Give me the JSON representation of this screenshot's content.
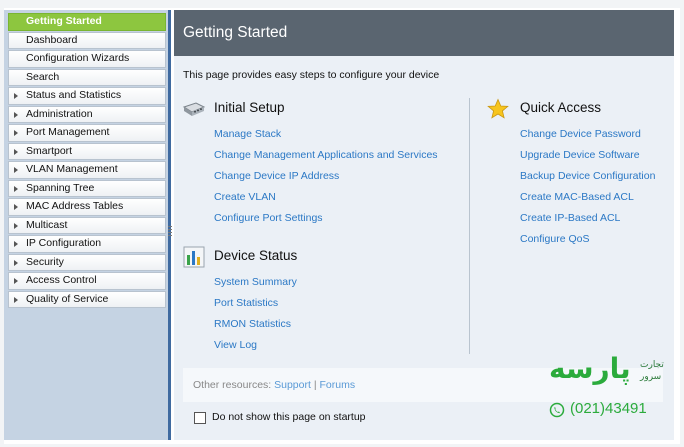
{
  "sidebar": {
    "items": [
      {
        "label": "Getting Started",
        "active": true,
        "arrow": false
      },
      {
        "label": "Dashboard",
        "active": false,
        "arrow": false
      },
      {
        "label": "Configuration Wizards",
        "active": false,
        "arrow": false
      },
      {
        "label": "Search",
        "active": false,
        "arrow": false
      },
      {
        "label": "Status and Statistics",
        "active": false,
        "arrow": true
      },
      {
        "label": "Administration",
        "active": false,
        "arrow": true
      },
      {
        "label": "Port Management",
        "active": false,
        "arrow": true
      },
      {
        "label": "Smartport",
        "active": false,
        "arrow": true
      },
      {
        "label": "VLAN Management",
        "active": false,
        "arrow": true
      },
      {
        "label": "Spanning Tree",
        "active": false,
        "arrow": true
      },
      {
        "label": "MAC Address Tables",
        "active": false,
        "arrow": true
      },
      {
        "label": "Multicast",
        "active": false,
        "arrow": true
      },
      {
        "label": "IP Configuration",
        "active": false,
        "arrow": true
      },
      {
        "label": "Security",
        "active": false,
        "arrow": true
      },
      {
        "label": "Access Control",
        "active": false,
        "arrow": true
      },
      {
        "label": "Quality of Service",
        "active": false,
        "arrow": true
      }
    ]
  },
  "main": {
    "title": "Getting Started",
    "intro": "This page provides easy steps to configure your device",
    "initial_setup": {
      "title": "Initial Setup",
      "links": [
        "Manage Stack",
        "Change Management Applications and Services",
        "Change Device IP Address",
        "Create VLAN",
        "Configure Port Settings"
      ]
    },
    "device_status": {
      "title": "Device Status",
      "links": [
        "System Summary",
        "Port Statistics",
        "RMON Statistics",
        "View Log"
      ]
    },
    "quick_access": {
      "title": "Quick Access",
      "links": [
        "Change Device Password",
        "Upgrade Device Software",
        "Backup Device Configuration",
        "Create MAC-Based ACL",
        "Create IP-Based ACL",
        "Configure QoS"
      ]
    },
    "resources": {
      "label": "Other resources:",
      "support": "Support",
      "separator": "|",
      "forums": "Forums"
    },
    "startup_checkbox": {
      "label": "Do not show this page on startup",
      "checked": false
    }
  },
  "watermark": {
    "brand": "پارسه",
    "tagline_1": "تجارت",
    "tagline_2": "سرور",
    "phone": "(021)43491"
  },
  "colors": {
    "active_nav": "#8dc63f",
    "header_bg": "#5a6570",
    "link": "#2b78c5",
    "sidebar_border": "#3f6aa0",
    "brand_green": "#2bab3c"
  }
}
